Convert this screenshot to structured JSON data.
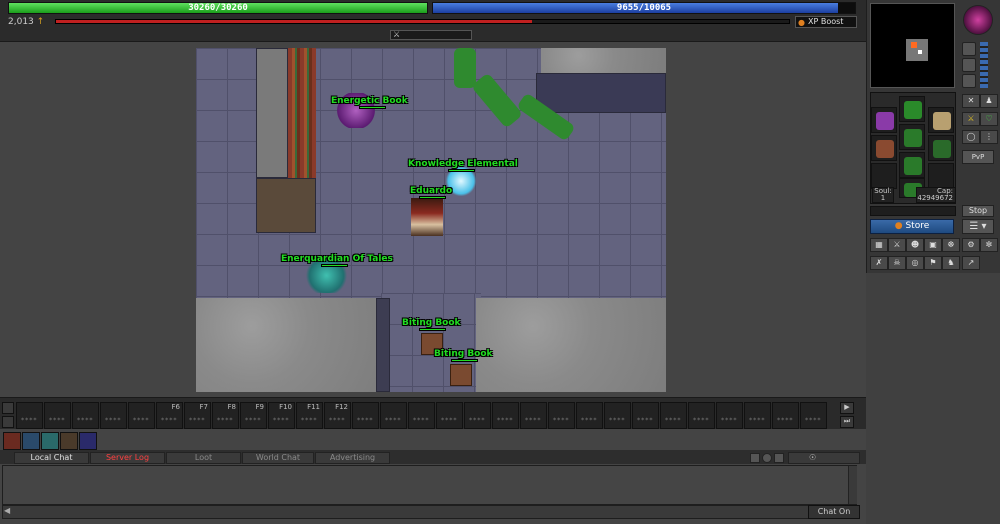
{
  "stats": {
    "health": "30260/30260",
    "health_fraction": 1.0,
    "mana": "9655/10065",
    "mana_fraction": 0.959,
    "level": "2,013",
    "xp_boost_label": "XP Boost"
  },
  "creatures": [
    {
      "name": "Energetic Book",
      "hp_fraction": 1.0
    },
    {
      "name": "Knowledge Elemental",
      "hp_fraction": 1.0
    },
    {
      "name": "Eduardo",
      "hp_fraction": 1.0
    },
    {
      "name": "Enerquardian Of Tales",
      "hp_fraction": 1.0
    },
    {
      "name": "Biting Book",
      "hp_fraction": 1.0
    },
    {
      "name": "Biting Book",
      "hp_fraction": 1.0
    }
  ],
  "equipment": {
    "soul_label": "Soul:",
    "soul_value": "1",
    "cap_label": "Cap:",
    "cap_value": "42949672"
  },
  "buttons": {
    "pvp": "PvP",
    "stop": "Stop",
    "store": "Store",
    "chat_on": "Chat On"
  },
  "hotkeys": [
    "F6",
    "F7",
    "F8",
    "F9",
    "F10",
    "F11",
    "F12"
  ],
  "chat_tabs": [
    {
      "label": "Local Chat",
      "color": "#e0e0e0"
    },
    {
      "label": "Server Log",
      "color": "#ff4040"
    },
    {
      "label": "Loot",
      "color": "#8a8a8a"
    },
    {
      "label": "World Chat",
      "color": "#8a8a8a"
    },
    {
      "label": "Advertising",
      "color": "#8a8a8a"
    }
  ],
  "colors": {
    "health": "#1b9e1b",
    "mana": "#1c3fa0",
    "name_text": "#22dd22",
    "store": "#2a5a98"
  }
}
